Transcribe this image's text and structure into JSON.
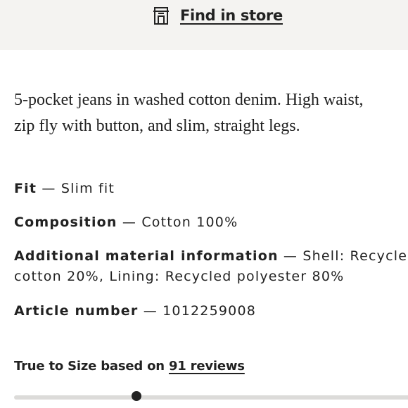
{
  "store_bar": {
    "icon": "store-icon",
    "label": "Find in store"
  },
  "description": {
    "line1": "5-pocket jeans in washed cotton denim. High waist,",
    "line2": "zip fly with button, and slim, straight legs."
  },
  "details": {
    "fit": {
      "term": "Fit",
      "value": " — Slim fit"
    },
    "composition": {
      "term": "Composition",
      "value": " — Cotton 100%"
    },
    "additional": {
      "term": "Additional material information",
      "value_line1": " — Shell: Recycled",
      "value_line2": "cotton 20%, Lining: Recycled polyester 80%"
    },
    "article": {
      "term": "Article number",
      "value": " — 1012259008"
    }
  },
  "fit_rating": {
    "prefix": "True to Size based on ",
    "reviews_link": "91 reviews",
    "position_fraction": 0.3
  }
}
